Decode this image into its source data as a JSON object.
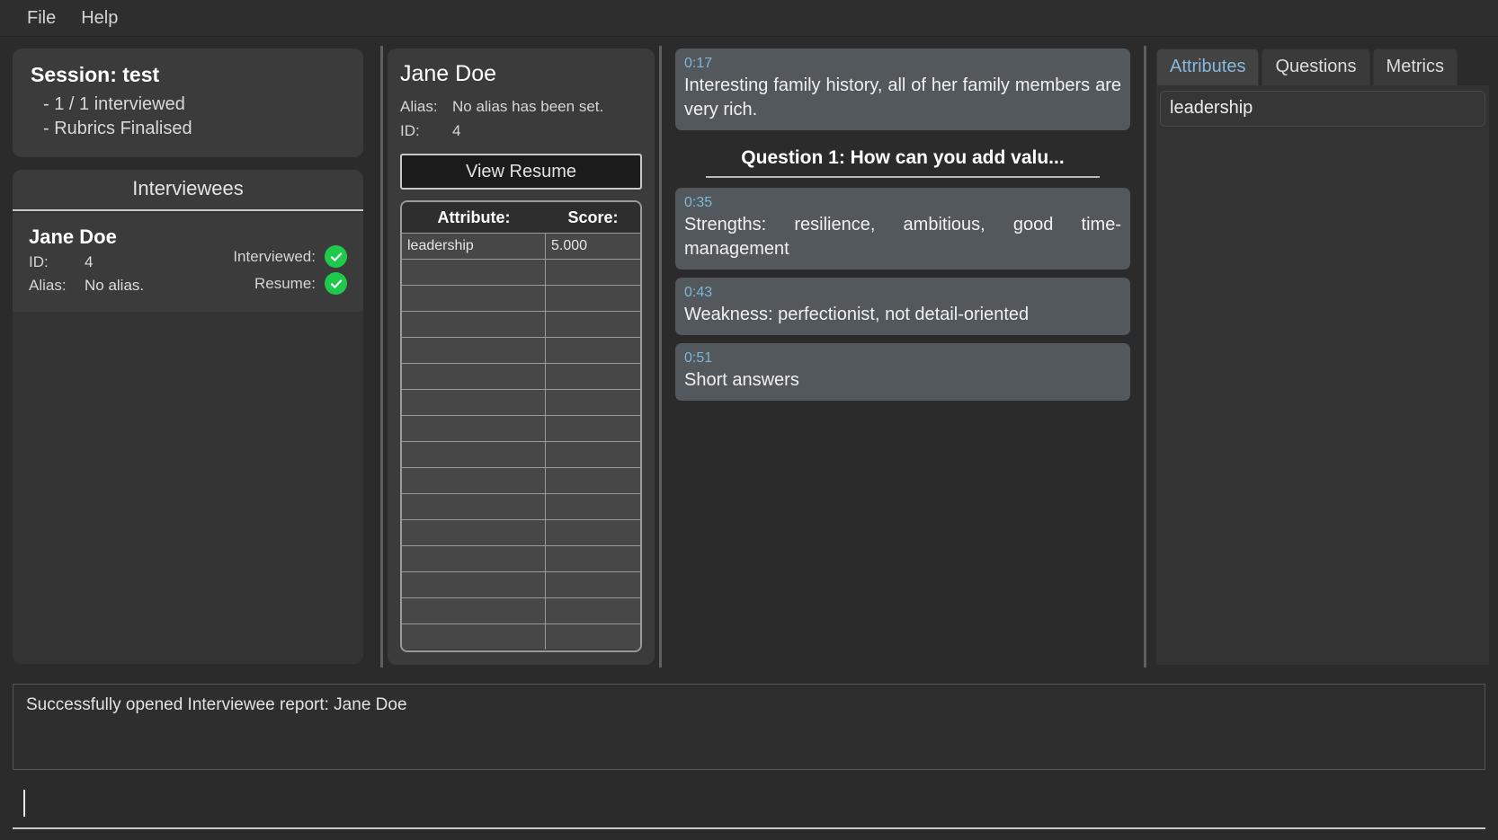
{
  "menubar": {
    "items": [
      "File",
      "Help"
    ]
  },
  "session": {
    "title": "Session: test",
    "lines": [
      "- 1 / 1 interviewed",
      "- Rubrics Finalised"
    ]
  },
  "interviewees": {
    "header": "Interviewees",
    "rows": [
      {
        "name": "Jane Doe",
        "id_label": "ID:",
        "id_value": "4",
        "alias_label": "Alias:",
        "alias_value": "No alias.",
        "interviewed_label": "Interviewed:",
        "interviewed_icon": "check-circle-icon",
        "resume_label": "Resume:",
        "resume_icon": "check-circle-icon"
      }
    ]
  },
  "profile": {
    "name": "Jane Doe",
    "alias_label": "Alias:",
    "alias_value": "No alias has been set.",
    "id_label": "ID:",
    "id_value": "4",
    "view_resume_label": "View Resume",
    "table": {
      "headers": [
        "Attribute:",
        "Score:"
      ],
      "rows": [
        [
          "leadership",
          "5.000"
        ],
        [
          "",
          ""
        ],
        [
          "",
          ""
        ],
        [
          "",
          ""
        ],
        [
          "",
          ""
        ],
        [
          "",
          ""
        ],
        [
          "",
          ""
        ],
        [
          "",
          ""
        ],
        [
          "",
          ""
        ],
        [
          "",
          ""
        ],
        [
          "",
          ""
        ],
        [
          "",
          ""
        ],
        [
          "",
          ""
        ],
        [
          "",
          ""
        ],
        [
          "",
          ""
        ],
        [
          "",
          ""
        ]
      ]
    }
  },
  "transcript": {
    "entries": [
      {
        "kind": "bubble",
        "time": "0:17",
        "text": "Interesting family history, all of her family members are very rich."
      },
      {
        "kind": "question",
        "text": "Question 1: How can you add valu..."
      },
      {
        "kind": "bubble",
        "time": "0:35",
        "text": "Strengths: resilience, ambitious, good time-management"
      },
      {
        "kind": "bubble",
        "time": "0:43",
        "text": "Weakness: perfectionist, not detail-oriented"
      },
      {
        "kind": "bubble",
        "time": "0:51",
        "text": "Short answers"
      }
    ]
  },
  "rightpanel": {
    "tabs": [
      {
        "label": "Attributes",
        "active": true
      },
      {
        "label": "Questions",
        "active": false
      },
      {
        "label": "Metrics",
        "active": false
      }
    ],
    "items": [
      "leadership"
    ]
  },
  "log": {
    "message": "Successfully opened Interviewee report: Jane Doe"
  },
  "command_input": {
    "value": ""
  },
  "colors": {
    "accent_blue": "#87b9dd",
    "timestamp_blue": "#7eb6d9",
    "success_green": "#1fc94b",
    "panel_bg": "#3b3b3b",
    "app_bg": "#2b2b2b",
    "bubble_bg": "#53585c"
  }
}
